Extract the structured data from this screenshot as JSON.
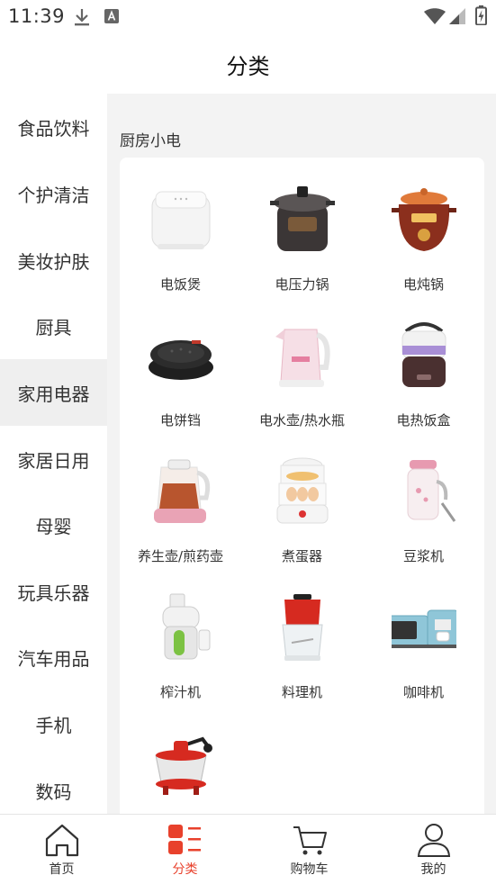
{
  "status_bar": {
    "time": "11:39"
  },
  "header": {
    "title": "分类"
  },
  "sidebar": {
    "items": [
      {
        "label": "食品饮料"
      },
      {
        "label": "个护清洁"
      },
      {
        "label": "美妆护肤"
      },
      {
        "label": "厨具"
      },
      {
        "label": "家用电器",
        "active": true
      },
      {
        "label": "家居日用"
      },
      {
        "label": "母婴"
      },
      {
        "label": "玩具乐器"
      },
      {
        "label": "汽车用品"
      },
      {
        "label": "手机"
      },
      {
        "label": "数码"
      }
    ]
  },
  "main": {
    "section_title": "厨房小电",
    "products": [
      {
        "label": "电饭煲",
        "icon": "rice-cooker-icon"
      },
      {
        "label": "电压力锅",
        "icon": "pressure-cooker-icon"
      },
      {
        "label": "电炖锅",
        "icon": "stew-pot-icon"
      },
      {
        "label": "电饼铛",
        "icon": "electric-griddle-icon"
      },
      {
        "label": "电水壶/热水瓶",
        "icon": "kettle-icon"
      },
      {
        "label": "电热饭盒",
        "icon": "lunch-box-icon"
      },
      {
        "label": "养生壶/煎药壶",
        "icon": "health-pot-icon"
      },
      {
        "label": "煮蛋器",
        "icon": "egg-boiler-icon"
      },
      {
        "label": "豆浆机",
        "icon": "soymilk-maker-icon"
      },
      {
        "label": "榨汁机",
        "icon": "juicer-icon"
      },
      {
        "label": "料理机",
        "icon": "food-processor-icon"
      },
      {
        "label": "咖啡机",
        "icon": "coffee-machine-icon"
      },
      {
        "label": "",
        "icon": "hand-chopper-icon"
      }
    ]
  },
  "bottom_nav": {
    "items": [
      {
        "label": "首页",
        "icon": "home-icon"
      },
      {
        "label": "分类",
        "icon": "category-icon",
        "active": true
      },
      {
        "label": "购物车",
        "icon": "cart-icon"
      },
      {
        "label": "我的",
        "icon": "profile-icon"
      }
    ]
  },
  "colors": {
    "accent": "#e8412c",
    "sidebar_active_bg": "#efefef",
    "main_bg": "#f3f3f3"
  }
}
